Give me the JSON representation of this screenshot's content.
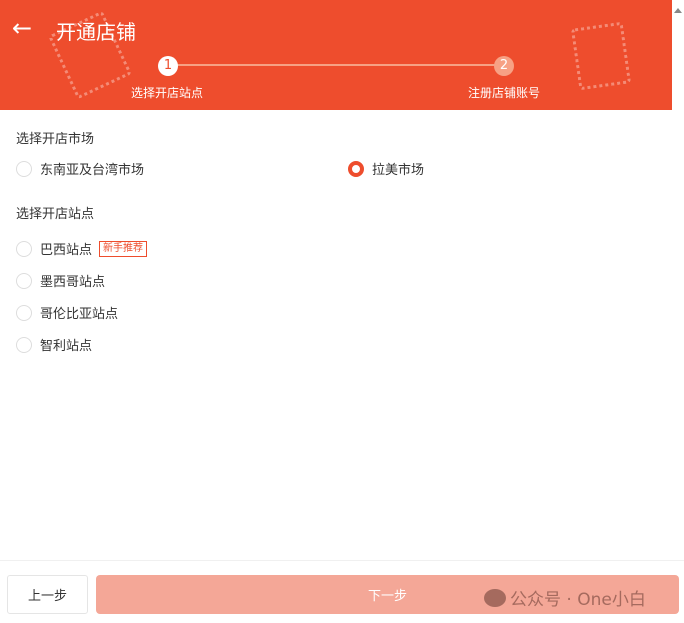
{
  "header": {
    "title": "开通店铺",
    "steps": [
      {
        "num": "1",
        "label": "选择开店站点"
      },
      {
        "num": "2",
        "label": "注册店铺账号"
      }
    ]
  },
  "market": {
    "heading": "选择开店市场",
    "options": [
      {
        "label": "东南亚及台湾市场",
        "selected": false
      },
      {
        "label": "拉美市场",
        "selected": true
      }
    ]
  },
  "site": {
    "heading": "选择开店站点",
    "options": [
      {
        "label": "巴西站点",
        "badge": "新手推荐"
      },
      {
        "label": "墨西哥站点"
      },
      {
        "label": "哥伦比亚站点"
      },
      {
        "label": "智利站点"
      }
    ]
  },
  "footer": {
    "prev": "上一步",
    "next": "下一步",
    "watermark": "公众号 · One小白"
  },
  "colors": {
    "brand": "#ee4d2d",
    "next_disabled": "#f4a797"
  }
}
